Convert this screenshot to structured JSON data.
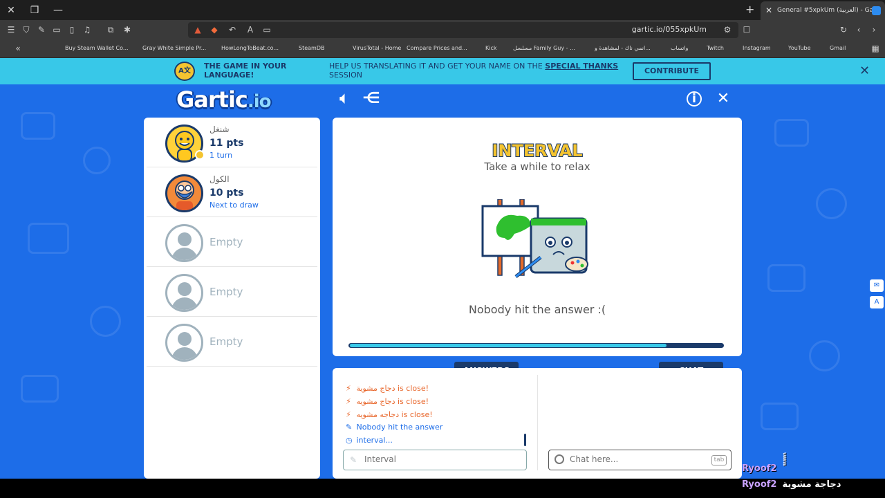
{
  "browser": {
    "tab_title": "General #5xpkUm (العربية) - Ga",
    "url": "gartic.io/055xpkUm",
    "bookmarks": [
      "Buy Steam Wallet Co...",
      "Gray White Simple Pr...",
      "HowLongToBeat.co...",
      "SteamDB",
      "VirusTotal - Home",
      "Compare Prices and...",
      "Kick",
      "مسلسل Family Guy - ...",
      "انمي ناك - لمشاهدة و...",
      "واتساب",
      "Twitch",
      "Instagram",
      "YouTube",
      "Gmail"
    ]
  },
  "banner": {
    "line1": "THE GAME IN YOUR LANGUAGE!",
    "line2_a": "HELP US TRANSLATING IT AND GET YOUR NAME ON THE",
    "line2_b": "SPECIAL THANKS",
    "line2_c": "SESSION",
    "contribute": "CONTRIBUTE"
  },
  "game": {
    "logo": "Gartic",
    "logo_suffix": ".io",
    "players": [
      {
        "name": "شنغل",
        "pts": "11 pts",
        "note": "1 turn"
      },
      {
        "name": "الكول",
        "pts": "10 pts",
        "note": "Next to draw"
      },
      {
        "empty": "Empty"
      },
      {
        "empty": "Empty"
      },
      {
        "empty": "Empty"
      }
    ],
    "card": {
      "title": "INTERVAL",
      "subtitle": "Take a while to relax",
      "message": "Nobody hit the answer :(",
      "progress": 0.85
    },
    "tabs": {
      "answers": "ANSWERS",
      "chat": "CHAT"
    },
    "answers": [
      {
        "text": "دجاج مشوية is close!",
        "type": "close"
      },
      {
        "text": "دجاج مشويه is close!",
        "type": "close"
      },
      {
        "text": "دجاجه مشويه is close!",
        "type": "close"
      },
      {
        "text": "Nobody hit the answer",
        "type": "info"
      },
      {
        "text": "interval...",
        "type": "info"
      }
    ],
    "answer_placeholder": "Interval",
    "chat_placeholder": "Chat here...",
    "tab_key": "tab"
  },
  "overlay": [
    {
      "user": "Ryoof2",
      "msg": "ًًًًًً"
    },
    {
      "user": "Ryoof2",
      "msg": "دجاجة مشوية"
    }
  ]
}
